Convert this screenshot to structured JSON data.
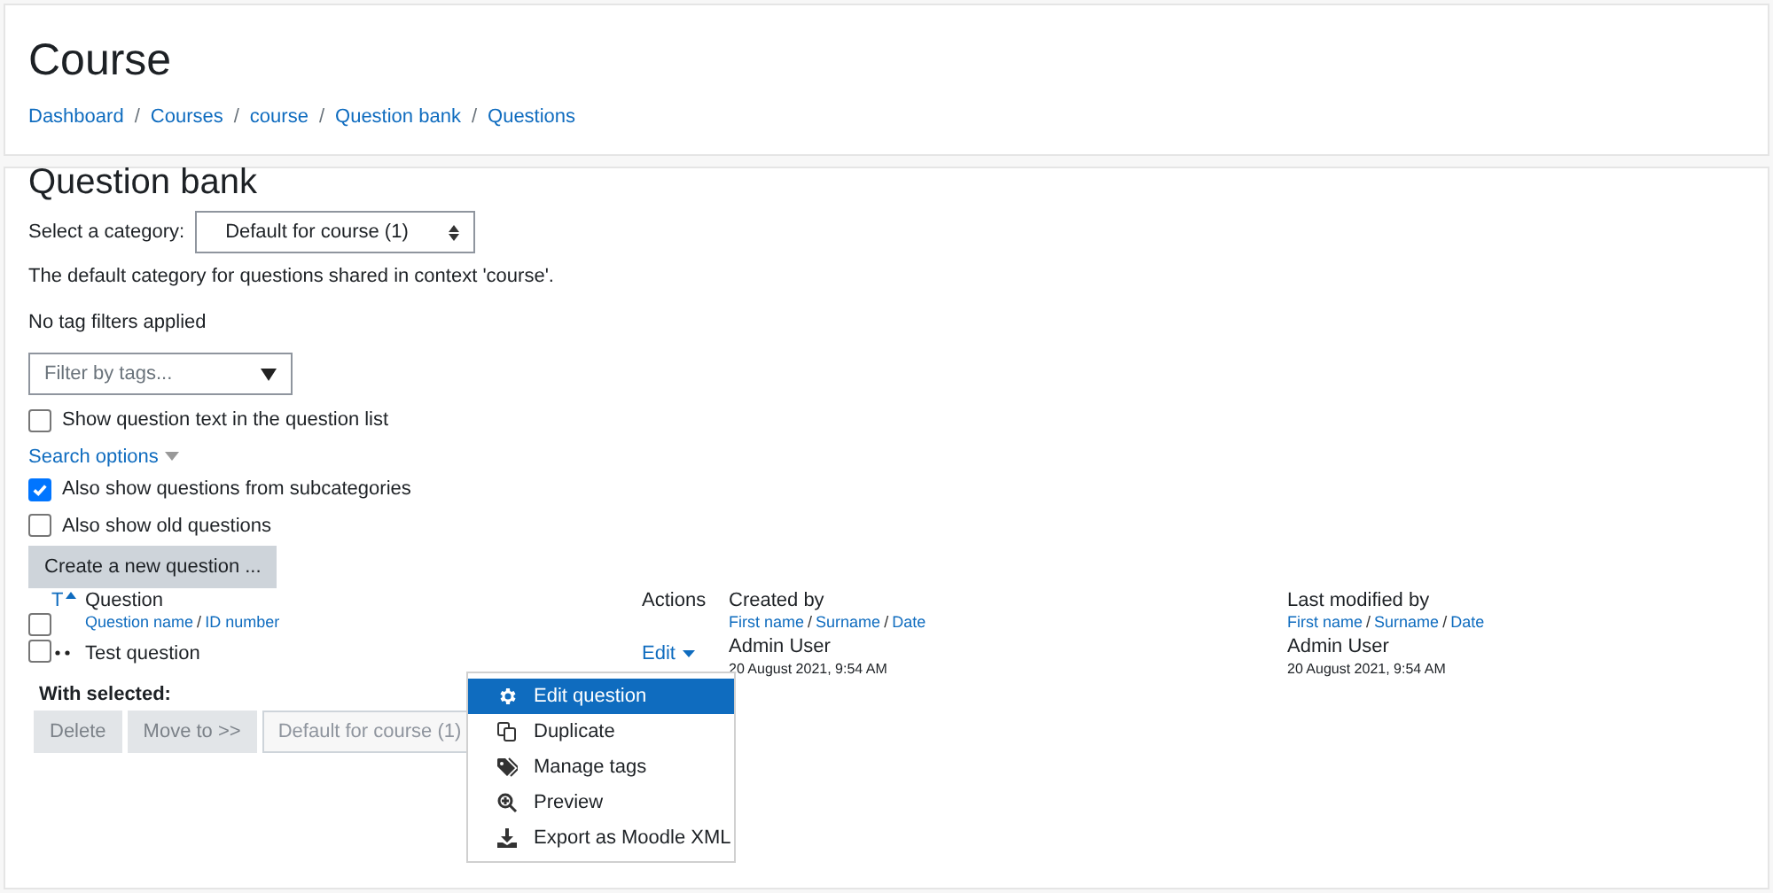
{
  "header": {
    "title": "Course",
    "separator": "/",
    "breadcrumb": [
      "Dashboard",
      "Courses",
      "course",
      "Question bank",
      "Questions"
    ]
  },
  "main": {
    "heading": "Question bank",
    "category_label": "Select a category:",
    "category_value": "Default for course (1)",
    "category_note": "The default category for questions shared in context 'course'.",
    "tag_status": "No tag filters applied",
    "tag_filter": {
      "placeholder": "Filter by tags..."
    },
    "options": [
      {
        "label": "Show question text in the question list",
        "checked": false
      }
    ],
    "search_options": "Search options",
    "search_checks": [
      {
        "label": "Also show questions from subcategories",
        "checked": true
      },
      {
        "label": "Also show old questions",
        "checked": false
      }
    ],
    "create_button": "Create a new question ..."
  },
  "table": {
    "sub_separator": "/",
    "select_all_checked": false,
    "type_sort": "T",
    "columns": [
      {
        "title": "Question",
        "sub": [
          "Question name",
          "ID number"
        ]
      },
      {
        "title": "Actions"
      },
      {
        "title": "Created by",
        "sub": [
          "First name",
          "Surname",
          "Date"
        ]
      },
      {
        "title": "Last modified by",
        "sub": [
          "First name",
          "Surname",
          "Date"
        ]
      }
    ],
    "rows": [
      {
        "checked": false,
        "name": "Test question",
        "action": "Edit",
        "created_by": "Admin User",
        "created_date": "20 August 2021, 9:54 AM",
        "modified_by": "Admin User",
        "modified_date": "20 August 2021, 9:54 AM"
      }
    ]
  },
  "with_selected": {
    "label": "With selected:",
    "buttons": [
      "Delete",
      "Move to >>"
    ],
    "category": "Default for course (1)"
  },
  "action_menu": [
    {
      "label": "Edit question",
      "kind": "gear",
      "selected": true
    },
    {
      "label": "Duplicate",
      "kind": "copy",
      "selected": false
    },
    {
      "label": "Manage tags",
      "kind": "tags",
      "selected": false
    },
    {
      "label": "Preview",
      "kind": "zoom",
      "selected": false
    },
    {
      "label": "Export as Moodle XML",
      "kind": "download",
      "selected": false
    }
  ]
}
